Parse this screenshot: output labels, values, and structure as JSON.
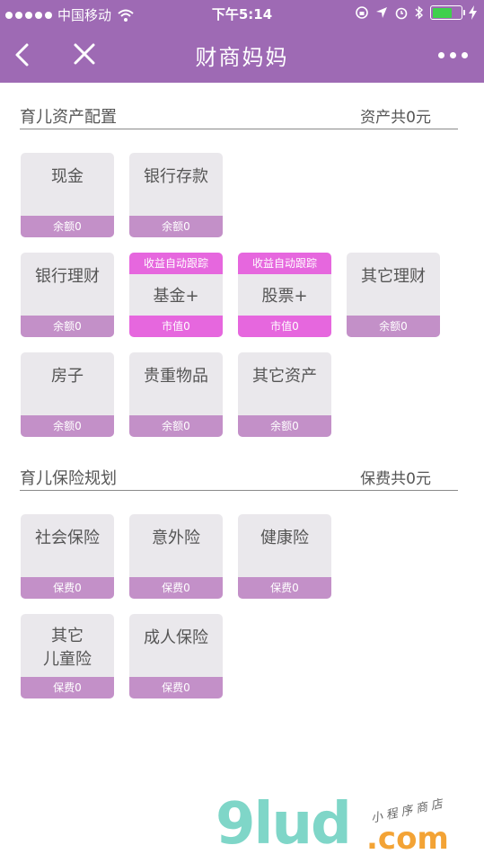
{
  "status_bar": {
    "carrier": "中国移动",
    "time": "下午5:14"
  },
  "nav": {
    "title": "财商妈妈"
  },
  "colors": {
    "header": "#9e6ab4",
    "card_bg": "#eae8ec",
    "card_footer": "#c390c8",
    "card_highlight": "#e667de"
  },
  "assets": {
    "title": "育儿资产配置",
    "total": "资产共0元",
    "cards": [
      {
        "title": "现金",
        "sub": "余额0"
      },
      {
        "title": "银行存款",
        "sub": "余额0"
      },
      {
        "title": "银行理财",
        "sub": "余额0"
      },
      {
        "title": "基金+",
        "sub": "市值0",
        "tag": "收益自动跟踪"
      },
      {
        "title": "股票+",
        "sub": "市值0",
        "tag": "收益自动跟踪"
      },
      {
        "title": "其它理财",
        "sub": "余额0"
      },
      {
        "title": "房子",
        "sub": "余额0"
      },
      {
        "title": "贵重物品",
        "sub": "余额0"
      },
      {
        "title": "其它资产",
        "sub": "余额0"
      }
    ]
  },
  "insurance": {
    "title": "育儿保险规划",
    "total": "保费共0元",
    "cards": [
      {
        "title": "社会保险",
        "sub": "保费0"
      },
      {
        "title": "意外险",
        "sub": "保费0"
      },
      {
        "title": "健康险",
        "sub": "保费0"
      },
      {
        "title_line1": "其它",
        "title_line2": "儿童险",
        "sub": "保费0"
      },
      {
        "title": "成人保险",
        "sub": "保费0"
      }
    ]
  },
  "watermark": {
    "main": "9lud",
    "com": ".com",
    "cn": "小程序商店"
  }
}
